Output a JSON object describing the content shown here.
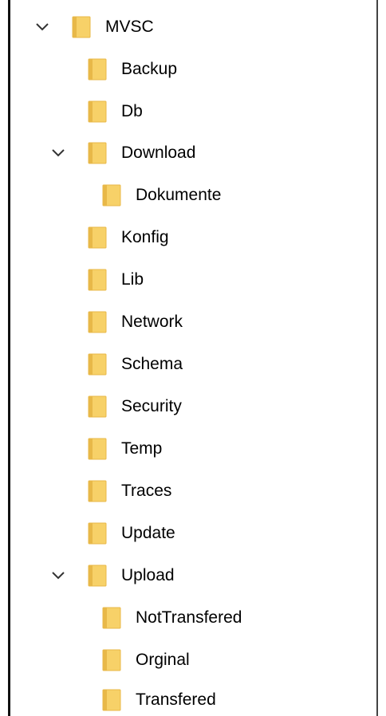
{
  "colors": {
    "folder_fill": "#f7d168",
    "folder_dark": "#e8b848",
    "chevron": "#333333"
  },
  "icons": {
    "folder": "folder-icon",
    "expand": "chevron-down-icon"
  },
  "tree": {
    "root": {
      "label": "MVSC",
      "expanded": true
    },
    "items": [
      {
        "label": "Backup"
      },
      {
        "label": "Db"
      },
      {
        "label": "Download",
        "expanded": true
      },
      {
        "label": "Dokumente"
      },
      {
        "label": "Konfig"
      },
      {
        "label": "Lib"
      },
      {
        "label": "Network"
      },
      {
        "label": "Schema"
      },
      {
        "label": "Security"
      },
      {
        "label": "Temp"
      },
      {
        "label": "Traces"
      },
      {
        "label": "Update"
      },
      {
        "label": "Upload",
        "expanded": true
      },
      {
        "label": "NotTransfered"
      },
      {
        "label": "Orginal"
      },
      {
        "label": "Transfered"
      }
    ]
  }
}
